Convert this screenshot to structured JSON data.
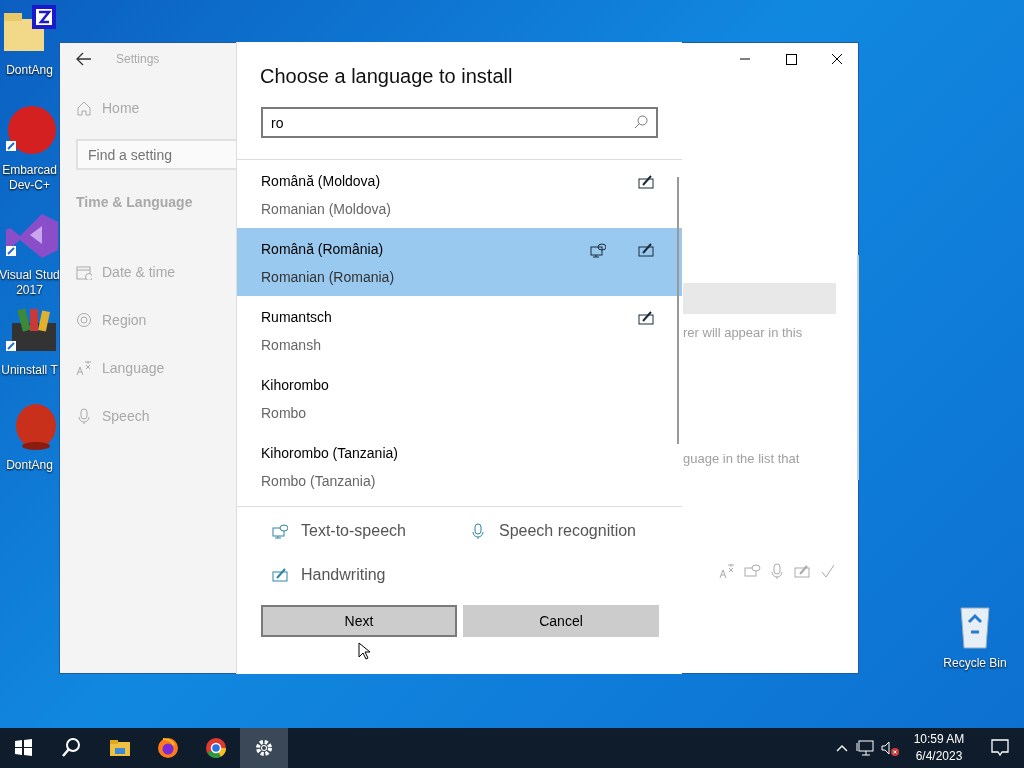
{
  "desktop": {
    "icons": [
      {
        "kind": "archive",
        "lines": [
          "DontAng"
        ]
      },
      {
        "kind": "devcpp",
        "lines": [
          "Embarcad",
          "Dev-C+"
        ]
      },
      {
        "kind": "studio",
        "lines": [
          "Visual Stud",
          "2017"
        ]
      },
      {
        "kind": "uninstall",
        "lines": [
          "Uninstall T"
        ]
      },
      {
        "kind": "bird",
        "lines": [
          "DontAng"
        ]
      }
    ],
    "recycle_bin": {
      "label": "Recycle Bin"
    }
  },
  "settings_window": {
    "title": "Settings",
    "home": "Home",
    "search": {
      "placeholder": "Find a setting"
    },
    "section": "Time & Language",
    "nav": [
      {
        "kind": "date",
        "label": "Date & time"
      },
      {
        "kind": "region",
        "label": "Region"
      },
      {
        "kind": "language",
        "label": "Language"
      },
      {
        "kind": "speech",
        "label": "Speech"
      }
    ],
    "content_texts": [
      "rer will appear in this",
      "guage in the list that"
    ]
  },
  "dialog": {
    "title": "Choose a language to install",
    "search": {
      "value": "ro"
    },
    "languages": [
      {
        "name": "Română (Moldova)",
        "english": "Romanian (Moldova)",
        "selected": false,
        "tts": false,
        "handwriting": true
      },
      {
        "name": "Română (România)",
        "english": "Romanian (Romania)",
        "selected": true,
        "tts": true,
        "handwriting": true
      },
      {
        "name": "Rumantsch",
        "english": "Romansh",
        "selected": false,
        "tts": false,
        "handwriting": true
      },
      {
        "name": "Kihorombo",
        "english": "Rombo",
        "selected": false,
        "tts": false,
        "handwriting": false
      },
      {
        "name": "Kihorombo (Tanzania)",
        "english": "Rombo (Tanzania)",
        "selected": false,
        "tts": false,
        "handwriting": false
      }
    ],
    "legend": [
      {
        "kind": "tts",
        "label": "Text-to-speech"
      },
      {
        "kind": "speech",
        "label": "Speech recognition"
      },
      {
        "kind": "handwriting",
        "label": "Handwriting"
      }
    ],
    "buttons": [
      {
        "label": "Next",
        "default": true
      },
      {
        "label": "Cancel",
        "default": false
      }
    ]
  },
  "taskbar": {
    "items": [
      {
        "kind": "start",
        "selected": false
      },
      {
        "kind": "search",
        "selected": false
      },
      {
        "kind": "explorer",
        "selected": false
      },
      {
        "kind": "firefox",
        "selected": false
      },
      {
        "kind": "chrome",
        "selected": false
      },
      {
        "kind": "settings",
        "selected": true
      }
    ],
    "time": "10:59 AM",
    "date": "6/4/2023"
  }
}
